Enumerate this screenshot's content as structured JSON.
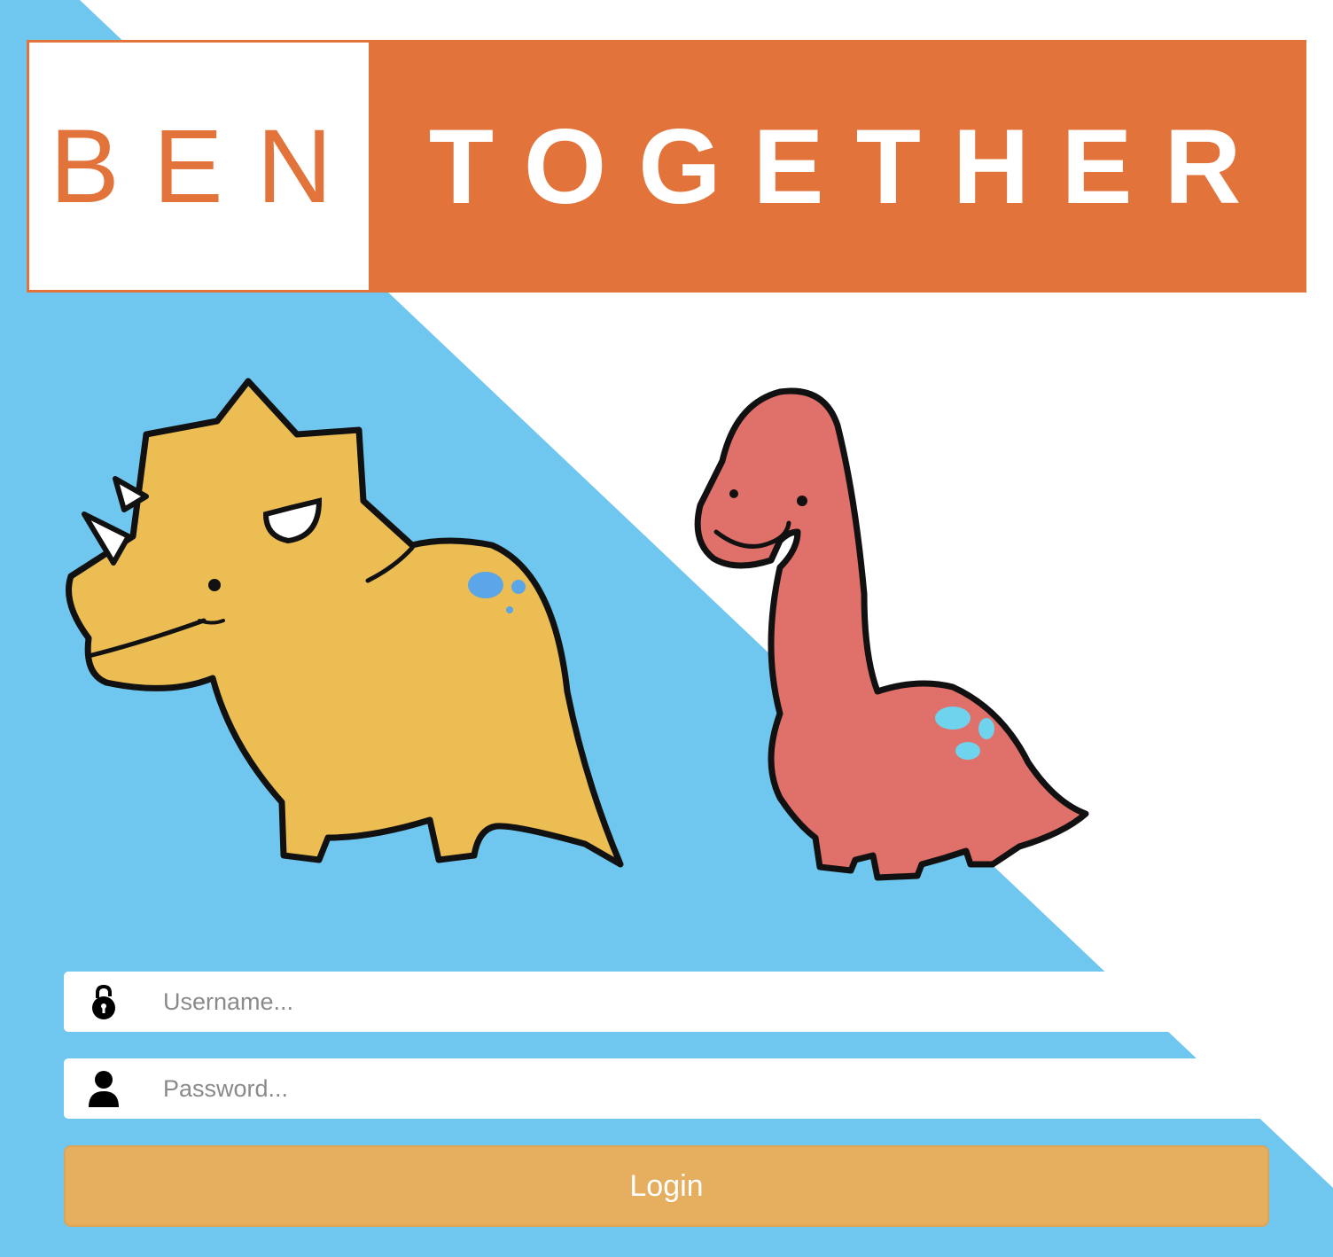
{
  "logo": {
    "left_text": "BEN",
    "right_text": "TOGETHER"
  },
  "colors": {
    "brand_orange": "#e2733a",
    "sky_blue": "#6fc6ee",
    "button": "#e6ae5f",
    "triceratops": "#ebbd52",
    "brontosaurus": "#e0706a"
  },
  "illustration": {
    "characters": [
      "triceratops",
      "brontosaurus"
    ]
  },
  "form": {
    "username": {
      "placeholder": "Username...",
      "value": "",
      "icon": "lock-icon"
    },
    "password": {
      "placeholder": "Password...",
      "value": "",
      "icon": "user-icon"
    },
    "login_label": "Login"
  }
}
